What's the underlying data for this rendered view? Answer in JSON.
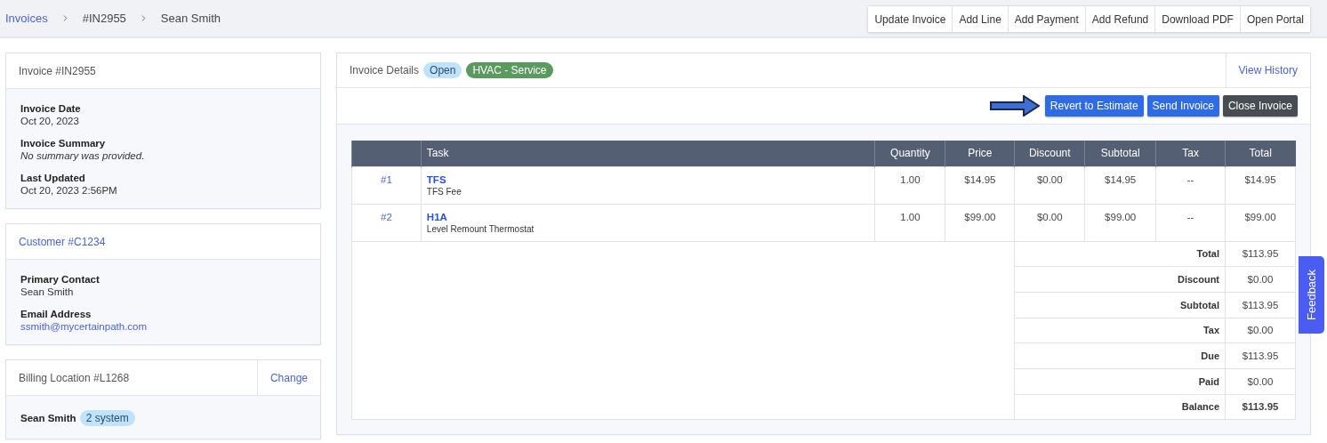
{
  "breadcrumb": [
    {
      "label": "Invoices",
      "kind": "link"
    },
    {
      "label": "#IN2955",
      "kind": "text"
    },
    {
      "label": "Sean Smith",
      "kind": "text"
    }
  ],
  "toolbar": [
    "Update Invoice",
    "Add Line",
    "Add Payment",
    "Add Refund",
    "Download PDF",
    "Open Portal"
  ],
  "invoice_card": {
    "title": "Invoice #IN2955",
    "fields": [
      {
        "label": "Invoice Date",
        "value": "Oct 20, 2023",
        "kind": "text"
      },
      {
        "label": "Invoice Summary",
        "value": "No summary was provided.",
        "kind": "empty"
      },
      {
        "label": "Last Updated",
        "value": "Oct 20, 2023 2:56PM",
        "kind": "text"
      }
    ]
  },
  "customer_card": {
    "title": "Customer #C1234",
    "fields": [
      {
        "label": "Primary Contact",
        "value": "Sean Smith",
        "kind": "text"
      },
      {
        "label": "Email Address",
        "value": "ssmith@mycertainpath.com",
        "kind": "link"
      }
    ]
  },
  "billing_card": {
    "title": "Billing Location #L1268",
    "action": "Change",
    "contact": {
      "name": "Sean Smith",
      "badge": "2 system"
    }
  },
  "details": {
    "title": "Invoice Details",
    "badges": [
      {
        "label": "Open",
        "kind": "status"
      },
      {
        "label": "HVAC - Service",
        "kind": "category"
      }
    ],
    "history_link": "View History",
    "actions": [
      {
        "label": "Revert to Estimate",
        "kind": "primary"
      },
      {
        "label": "Send Invoice",
        "kind": "primary"
      },
      {
        "label": "Close Invoice",
        "kind": "dark"
      }
    ]
  },
  "table": {
    "columns": [
      "",
      "Task",
      "Quantity",
      "Price",
      "Discount",
      "Subtotal",
      "Tax",
      "Total"
    ],
    "rows": [
      {
        "index": "#1",
        "code": "TFS",
        "description": "TFS Fee",
        "quantity": "1.00",
        "price": "$14.95",
        "discount": "$0.00",
        "subtotal": "$14.95",
        "tax": "--",
        "total": "$14.95"
      },
      {
        "index": "#2",
        "code": "H1A",
        "description": "Level Remount Thermostat",
        "quantity": "1.00",
        "price": "$99.00",
        "discount": "$0.00",
        "subtotal": "$99.00",
        "tax": "--",
        "total": "$99.00"
      }
    ],
    "summary": [
      {
        "label": "Total",
        "value": "$113.95",
        "bold": false
      },
      {
        "label": "Discount",
        "value": "$0.00",
        "bold": false
      },
      {
        "label": "Subtotal",
        "value": "$113.95",
        "bold": false
      },
      {
        "label": "Tax",
        "value": "$0.00",
        "bold": false
      },
      {
        "label": "Due",
        "value": "$113.95",
        "bold": false
      },
      {
        "label": "Paid",
        "value": "$0.00",
        "bold": false
      },
      {
        "label": "Balance",
        "value": "$113.95",
        "bold": true
      }
    ]
  },
  "feedback": "Feedback"
}
